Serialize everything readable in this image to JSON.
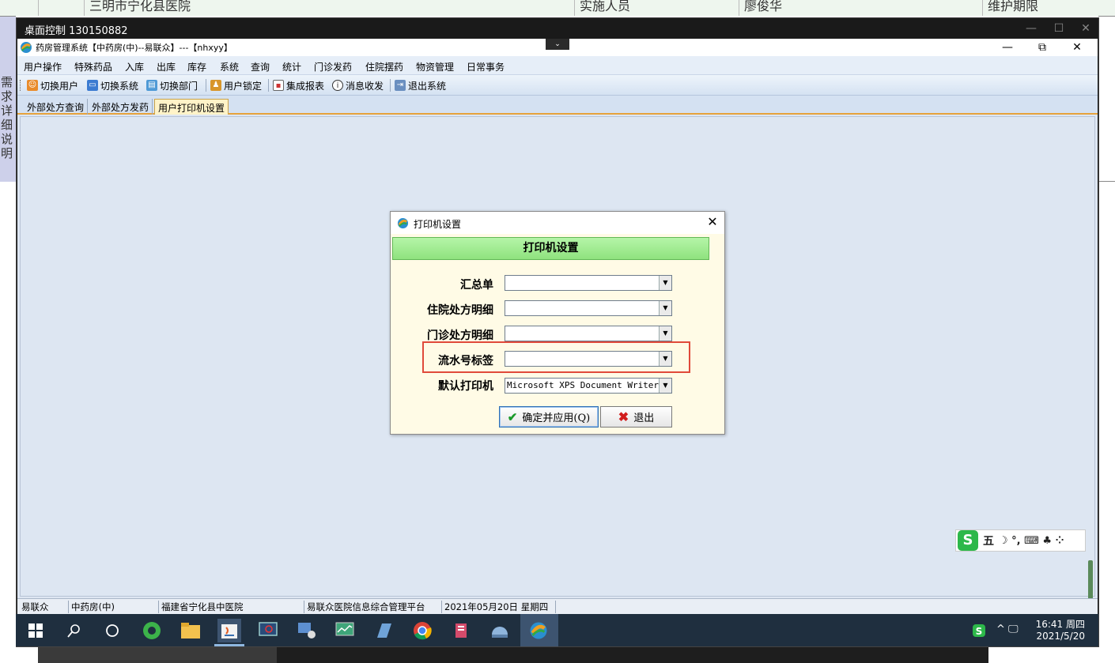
{
  "background": {
    "top_cells": [
      "三明市宁化县医院",
      "实施人员",
      "廖俊华",
      "维护期限"
    ],
    "side_text": "需求详细说明"
  },
  "remote": {
    "title": "桌面控制 130150882",
    "minimize": "—",
    "maximize": "☐",
    "close": "✕"
  },
  "app": {
    "title": "药房管理系统【中药房(中)--易联众】---【nhxyy】",
    "dropdown": "⌄",
    "minimize": "—",
    "restore": "⧉",
    "close": "✕",
    "menu": [
      "用户操作",
      "特殊药品",
      "入库",
      "出库",
      "库存",
      "系统",
      "查询",
      "统计",
      "门诊发药",
      "住院摆药",
      "物资管理",
      "日常事务"
    ],
    "toolbar": [
      "切换用户",
      "切换系统",
      "切换部门",
      "用户锁定",
      "集成报表",
      "消息收发",
      "退出系统"
    ],
    "tabs": [
      "外部处方查询",
      "外部处方发药",
      "用户打印机设置"
    ],
    "status": [
      "易联众",
      "中药房(中)",
      "福建省宁化县中医院",
      "易联众医院信息综合管理平台",
      "2021年05月20日 星期四"
    ]
  },
  "dialog": {
    "title": "打印机设置",
    "banner": "打印机设置",
    "close": "✕",
    "fields": [
      {
        "label": "汇总单",
        "value": ""
      },
      {
        "label": "住院处方明细",
        "value": ""
      },
      {
        "label": "门诊处方明细",
        "value": ""
      },
      {
        "label": "流水号标签",
        "value": ""
      },
      {
        "label": "默认打印机",
        "value": "Microsoft XPS Document Writer"
      }
    ],
    "ok_label": "确定并应用(Q)",
    "cancel_label": "退出",
    "highlight_color": "#e04a3a"
  },
  "ime": {
    "logo": "S",
    "mode": "五",
    "symbols": "☽ °, ⌨ ♣ ⁘"
  },
  "taskbar": {
    "time": "16:41 周四",
    "date": "2021/5/20",
    "tray_symbols": "^ 🖵"
  }
}
